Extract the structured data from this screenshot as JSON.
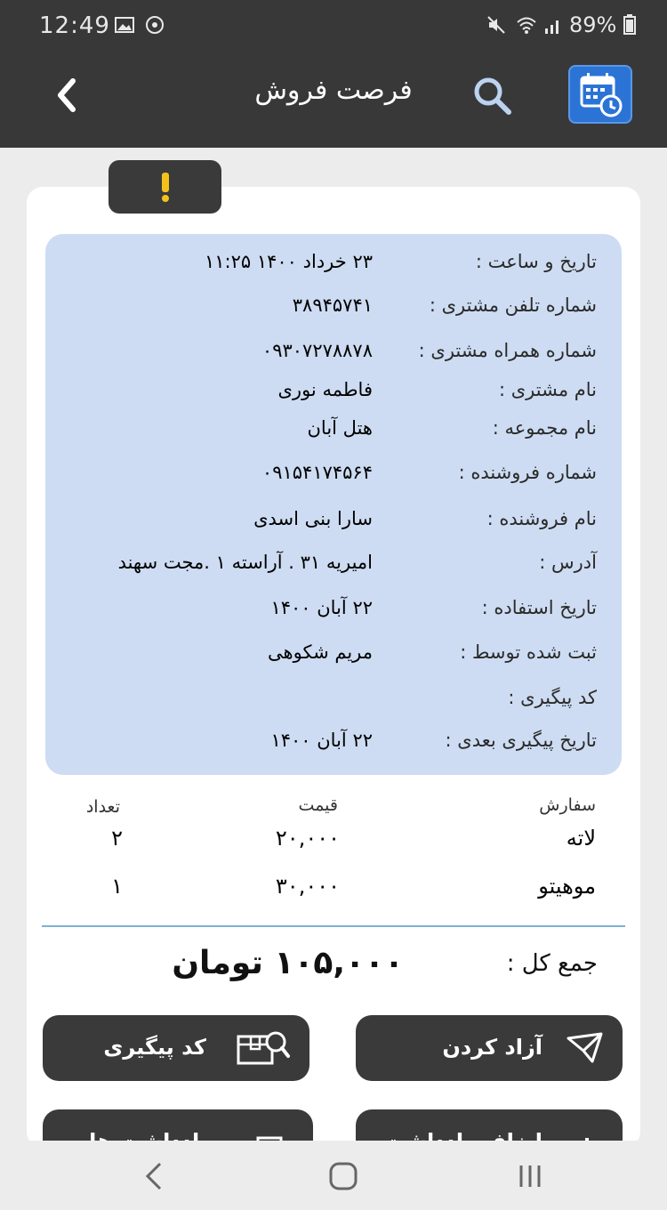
{
  "status": {
    "time": "12:49",
    "battery": "89%"
  },
  "header": {
    "title": "فرصت فروش"
  },
  "details": [
    {
      "label": "تاریخ و ساعت :",
      "value": "۲۳ خرداد ۱۴۰۰   ۱۱:۲۵"
    },
    {
      "label": "شماره تلفن مشتری :",
      "value": "۳۸۹۴۵۷۴۱"
    },
    {
      "label": "شماره همراه مشتری :",
      "value": "۰۹۳۰۷۲۷۸۸۷۸"
    },
    {
      "label": "نام مشتری :",
      "value": "فاطمه نوری"
    },
    {
      "label": "نام مجموعه :",
      "value": "هتل آبان"
    },
    {
      "label": "شماره فروشنده :",
      "value": "۰۹۱۵۴۱۷۴۵۶۴"
    },
    {
      "label": "نام فروشنده :",
      "value": "سارا بنی اسدی"
    },
    {
      "label": "آدرس :",
      "value": "امیریه ۳۱ . آراسته ۱ .مجت سهند"
    },
    {
      "label": "تاریخ استفاده :",
      "value": "۲۲ آبان ۱۴۰۰"
    },
    {
      "label": "ثبت شده توسط :",
      "value": "مریم شکوهی"
    },
    {
      "label": "کد پیگیری :",
      "value": ""
    },
    {
      "label": "تاریخ پیگیری بعدی :",
      "value": "۲۲ آبان ۱۴۰۰"
    }
  ],
  "orders": {
    "headers": {
      "item": "سفارش",
      "price": "قیمت",
      "qty": "تعداد"
    },
    "rows": [
      {
        "item": "لاته",
        "price": "۲۰,۰۰۰",
        "qty": "۲"
      },
      {
        "item": "موهیتو",
        "price": "۳۰,۰۰۰",
        "qty": "۱"
      }
    ]
  },
  "total": {
    "label": "جمع کل  :",
    "value": "۱۰۵,۰۰۰ تومان"
  },
  "buttons": {
    "tracking_code": "کد پیگیری",
    "release": "آزاد کردن",
    "notes": "یادداشت ها",
    "add_note": "اضافه یادداشت"
  },
  "colors": {
    "dark": "#383838",
    "info_bg": "#cddcf2",
    "accent": "#2b74d6",
    "warning": "#f2c21b"
  }
}
